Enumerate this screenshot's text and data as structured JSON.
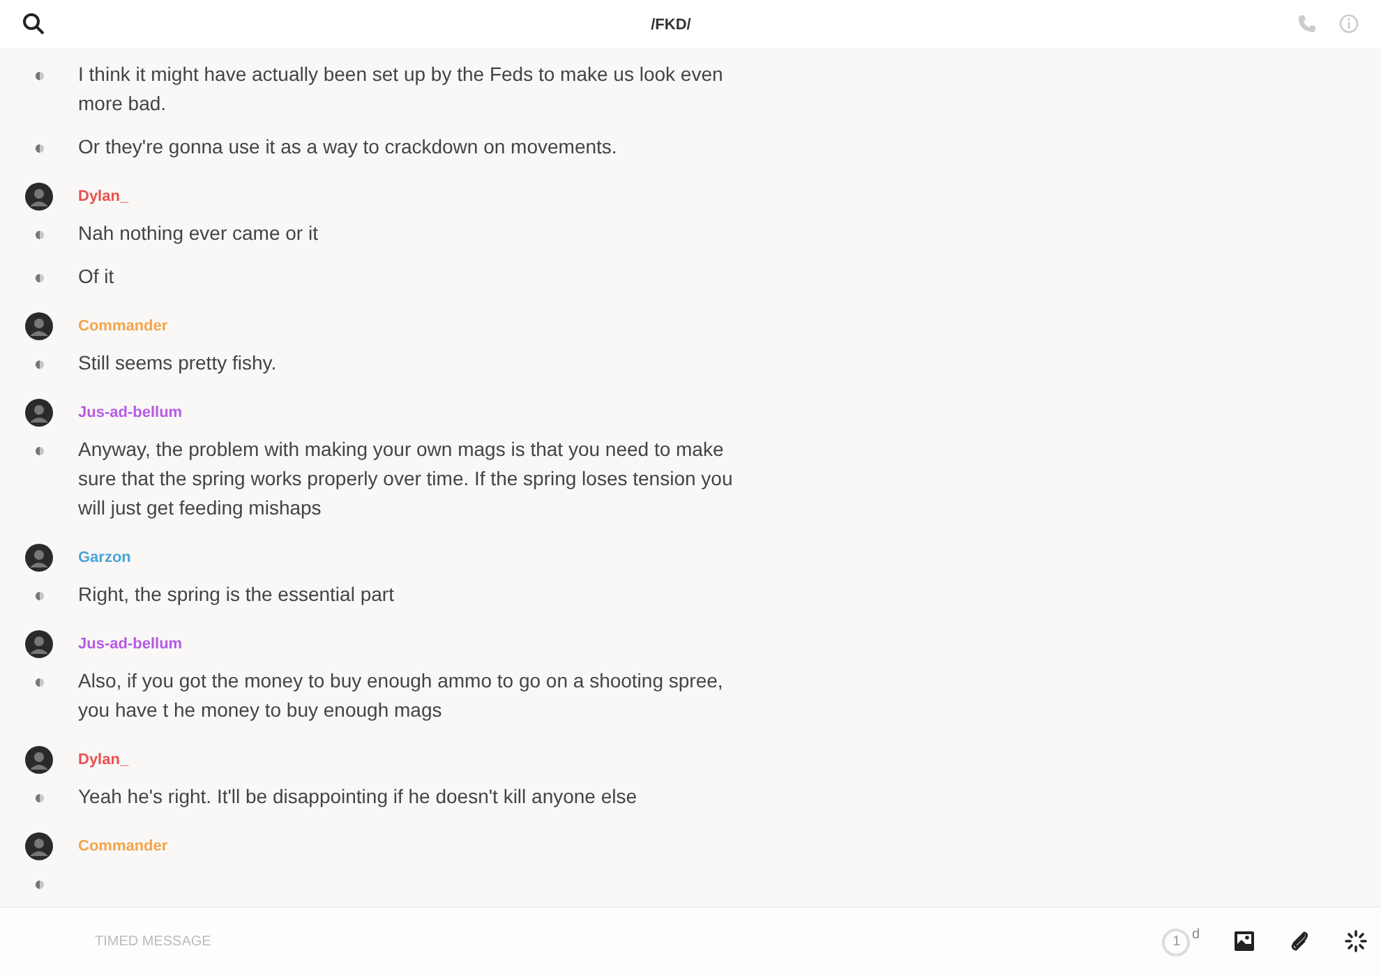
{
  "header": {
    "title": "/FKD/"
  },
  "groups": [
    {
      "continued": true,
      "messages": [
        "I think it might have actually been set up by the Feds to make us look even more bad.",
        "Or they're gonna use it as a way to crackdown on movements."
      ]
    },
    {
      "author": "Dylan_",
      "color": "#e8514f",
      "messages": [
        "Nah nothing ever came or it",
        "Of it"
      ]
    },
    {
      "author": "Commander",
      "color": "#f5a449",
      "messages": [
        "Still seems pretty fishy."
      ]
    },
    {
      "author": "Jus-ad-bellum",
      "color": "#b65ae6",
      "messages": [
        "Anyway, the problem with making your own mags is that you need to make sure that the spring works properly over time. If the spring loses tension you will just get feeding mishaps"
      ]
    },
    {
      "author": "Garzon",
      "color": "#4aa3d8",
      "messages": [
        "Right, the spring is the essential part"
      ]
    },
    {
      "author": "Jus-ad-bellum",
      "color": "#b65ae6",
      "messages": [
        "Also, if you got the money to buy enough ammo to go on a shooting spree, you have t he money to buy enough mags"
      ]
    },
    {
      "author": "Dylan_",
      "color": "#e8514f",
      "messages": [
        "Yeah he's right. It'll be disappointing if he doesn't kill anyone else"
      ]
    },
    {
      "author": "Commander",
      "color": "#f5a449",
      "pending": true
    }
  ],
  "composer": {
    "placeholder": "TIMED MESSAGE",
    "timer_value": "1",
    "timer_unit": "d"
  }
}
